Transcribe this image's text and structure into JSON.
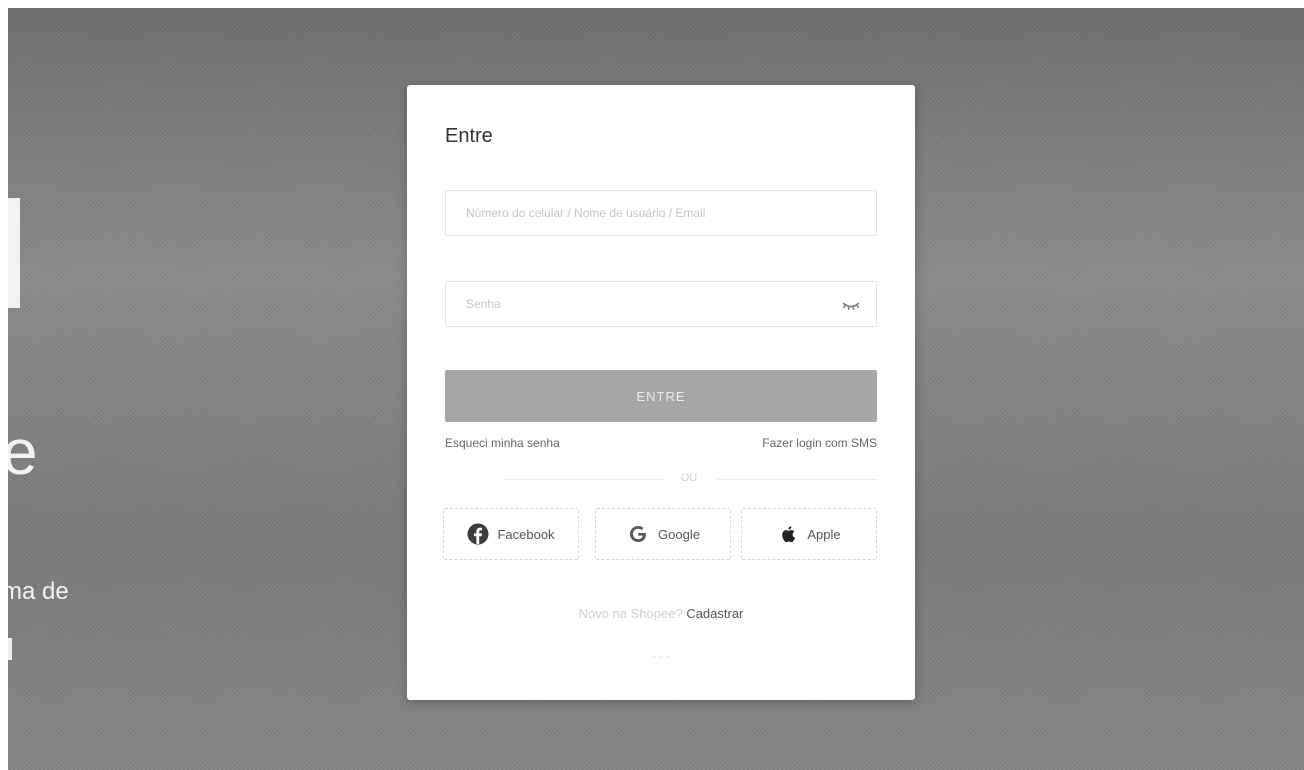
{
  "background": {
    "headline_fragment": "e",
    "tagline_fragment": "ma de"
  },
  "login": {
    "title": "Entre",
    "username_placeholder": "Número do celular / Nome de usuário / Email",
    "password_placeholder": "Senha",
    "password_toggle_icon": "eye-closed-icon",
    "login_button_label": "ENTRE",
    "forgot_password_label": "Esqueci minha senha",
    "sms_login_label": "Fazer login com SMS",
    "divider_label": "OU",
    "social": [
      {
        "label": "Facebook",
        "icon": "facebook-icon"
      },
      {
        "label": "Google",
        "icon": "google-icon"
      },
      {
        "label": "Apple",
        "icon": "apple-icon"
      }
    ],
    "signup_prompt": "Novo na Shopee?",
    "signup_label": "Cadastrar",
    "footer_mark": "- - -"
  },
  "colors": {
    "overlay": "#7e7e7e",
    "login_button": "#a6a6a6",
    "modal_background": "#ffffff"
  }
}
